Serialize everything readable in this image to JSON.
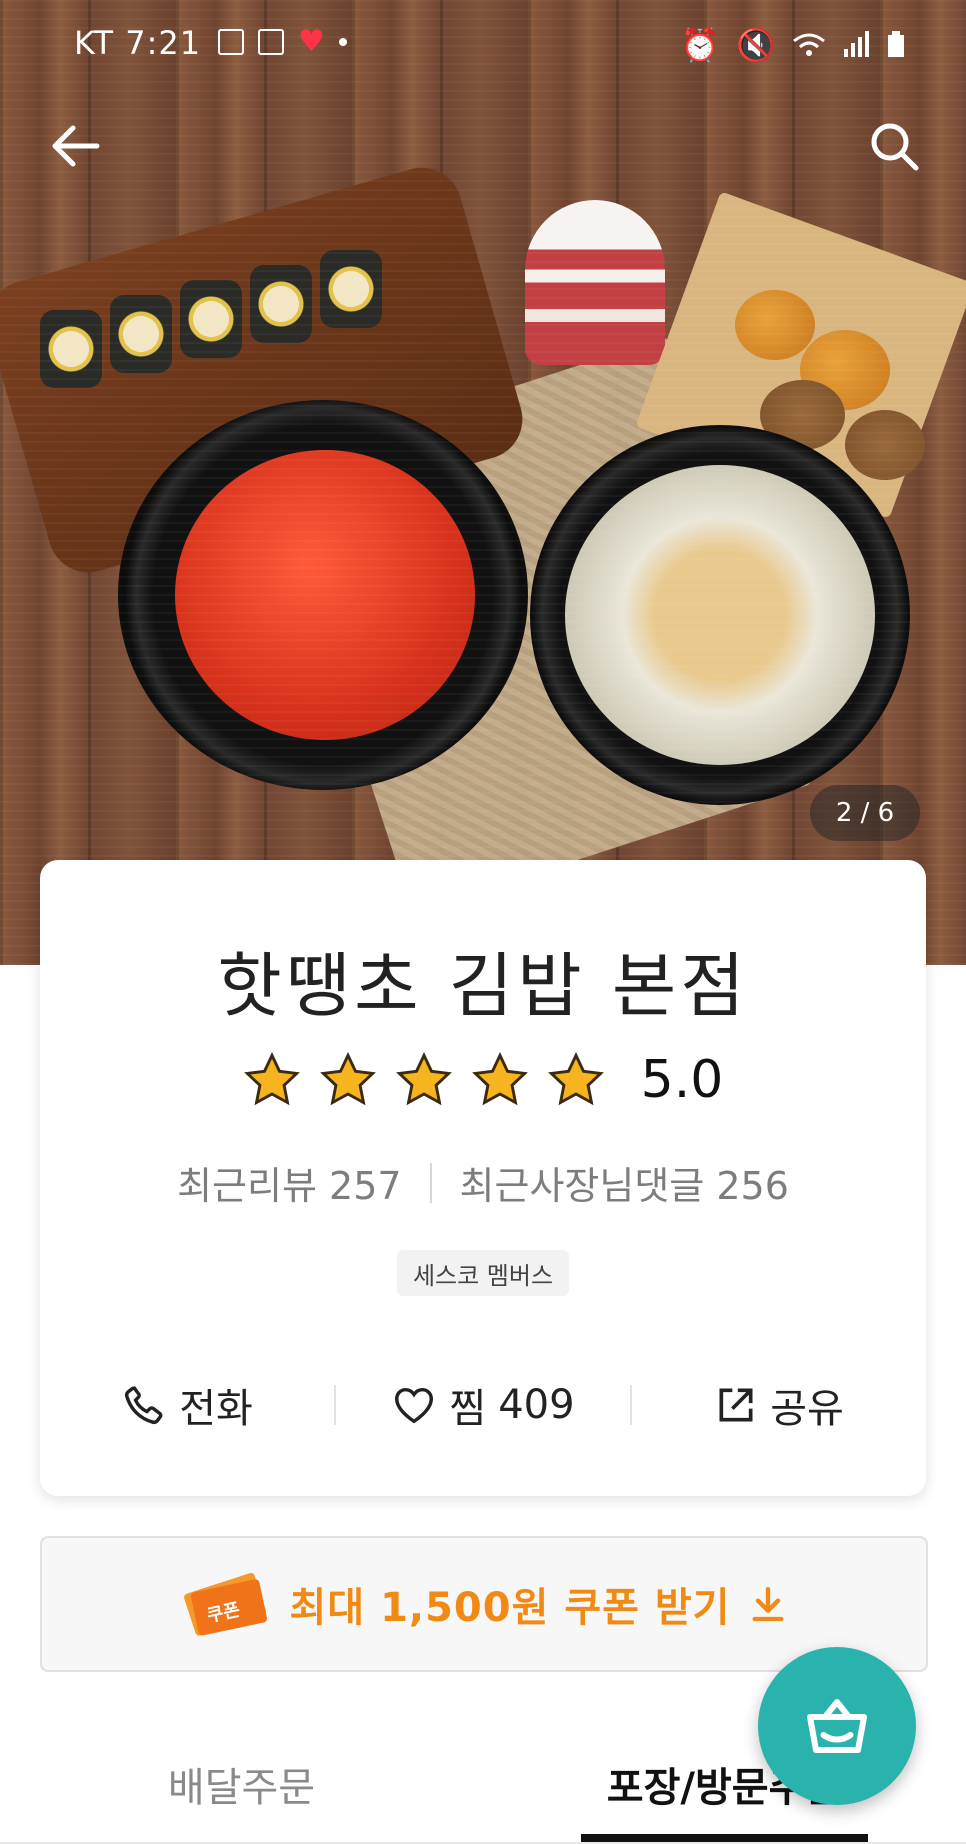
{
  "status_bar": {
    "carrier": "KT",
    "time": "7:21"
  },
  "header": {
    "back_icon": "arrow-left-icon",
    "search_icon": "search-icon"
  },
  "gallery": {
    "pager": "2 / 6"
  },
  "store": {
    "name": "핫땡초 김밥 본점",
    "rating_value": "5.0",
    "rating_stars": 5,
    "recent_reviews": "최근리뷰 257",
    "owner_replies": "최근사장님댓글 256",
    "badge": "세스코 멤버스"
  },
  "actions": {
    "call_label": "전화",
    "favorite_label": "찜",
    "favorite_count": "409",
    "share_label": "공유"
  },
  "coupon": {
    "ticket_text": "쿠폰",
    "label": "최대 1,500원 쿠폰 받기"
  },
  "tabs": [
    {
      "label": "배달주문",
      "active": false
    },
    {
      "label": "포장/방문주문",
      "active": true
    }
  ],
  "colors": {
    "accent_orange": "#f08a14",
    "fab_teal": "#2ab3ad",
    "star_yellow": "#f6b51e"
  }
}
